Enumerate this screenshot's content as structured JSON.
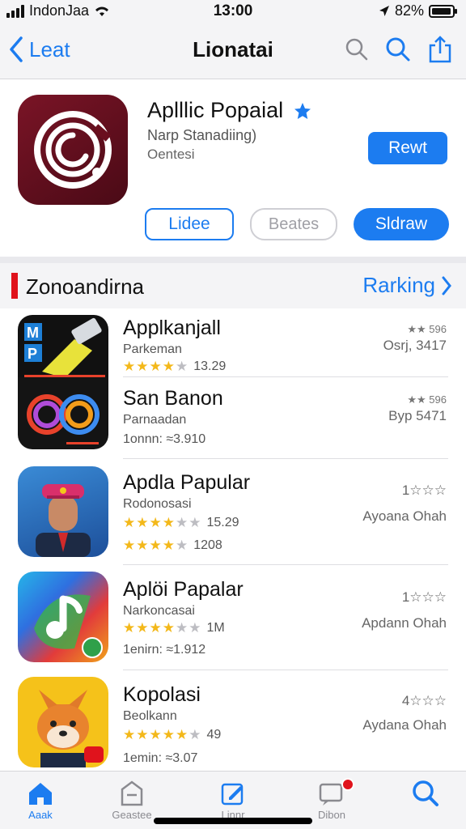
{
  "status_bar": {
    "carrier": "IndonJaa",
    "time": "13:00",
    "battery": "82%"
  },
  "nav": {
    "back_label": "Leat",
    "title": "Lionatai"
  },
  "hero": {
    "app_name": "Aplllic Popaial",
    "subtitle1": "Narp Stanadiing)",
    "subtitle2": "Oentesi",
    "primary_button": "Rewt",
    "buttons": [
      "Lidee",
      "Beates",
      "Sldraw"
    ]
  },
  "section": {
    "title": "Zonoandirna",
    "link": "Rarking"
  },
  "apps": [
    {
      "name": "Applkanjall",
      "category": "Parkeman",
      "rating_value": "13.29",
      "stars": 4,
      "right_top": "★★ 596",
      "right_bottom": "Osrj, 3417"
    },
    {
      "name": "San Banon",
      "category": "Parnaadan",
      "meta": "1onnn: ≈3.910",
      "right_top": "★★ 596",
      "right_bottom": "Byp 5471"
    },
    {
      "name": "Apdla Papular",
      "category": "Rodonosasi",
      "rating_value": "15.29",
      "stars": 4,
      "rating_value2": "1208",
      "stars2": 4,
      "right_top": "1☆☆☆",
      "right_bottom": "Ayoana Ohah"
    },
    {
      "name": "Aplöi Papalar",
      "category": "Narkoncasai",
      "rating_value": "1M",
      "stars": 4,
      "meta": "1enirn: ≈1.912",
      "right_top": "1☆☆☆",
      "right_bottom": "Apdann Ohah"
    },
    {
      "name": "Kopolasi",
      "category": "Beolkann",
      "rating_value": "49",
      "stars": 5,
      "meta": "1emin: ≈3.07",
      "right_top": "4☆☆☆",
      "right_bottom": "Aydana Ohah"
    }
  ],
  "tabs": [
    {
      "label": "Aaak",
      "icon": "home-icon"
    },
    {
      "label": "Geastee",
      "icon": "list-icon"
    },
    {
      "label": "Linnr",
      "icon": "edit-icon"
    },
    {
      "label": "Dibon",
      "icon": "message-icon",
      "badge": true
    },
    {
      "label": "",
      "icon": "search-icon"
    }
  ],
  "colors": {
    "accent": "#1c7cf0",
    "brand_icon": "#7a1426",
    "section_mark": "#e0131c",
    "stars": "#f3b81a"
  }
}
